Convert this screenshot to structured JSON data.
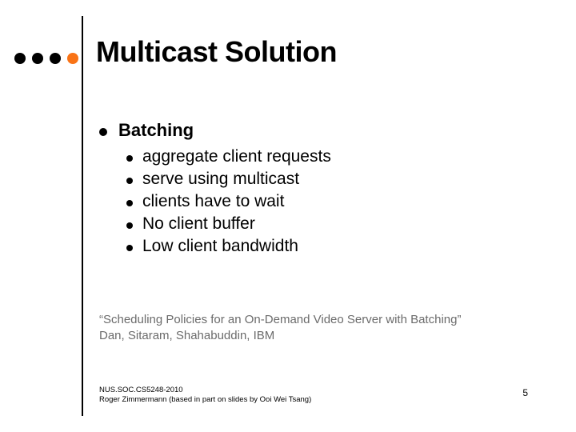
{
  "title": "Multicast Solution",
  "bullets": {
    "l1": "Batching",
    "l2": [
      "aggregate client requests",
      "serve using multicast",
      "clients have to wait",
      "No client buffer",
      "Low client bandwidth"
    ]
  },
  "citation": {
    "line1": "“Scheduling Policies for an On-Demand Video Server with Batching”",
    "line2": "Dan, Sitaram, Shahabuddin, IBM"
  },
  "footer": {
    "line1": "NUS.SOC.CS5248-2010",
    "line2": "Roger Zimmermann (based in part on slides by Ooi Wei Tsang)"
  },
  "page_number": "5"
}
